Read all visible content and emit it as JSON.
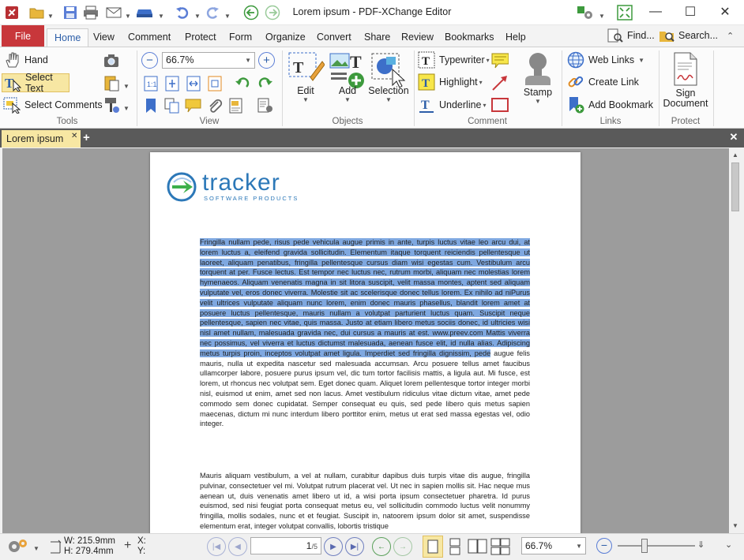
{
  "window": {
    "title": "Lorem ipsum - PDF-XChange Editor"
  },
  "menu": {
    "file": "File",
    "tabs": [
      "Home",
      "View",
      "Comment",
      "Protect",
      "Form",
      "Organize",
      "Convert",
      "Share",
      "Review",
      "Bookmarks",
      "Help"
    ],
    "find": "Find...",
    "search": "Search..."
  },
  "ribbon": {
    "tools": {
      "hand": "Hand",
      "select_text": "Select Text",
      "select_comments": "Select Comments",
      "label": "Tools"
    },
    "view": {
      "zoom": "66.7%",
      "label": "View"
    },
    "objects": {
      "edit": "Edit",
      "add": "Add",
      "selection": "Selection",
      "label": "Objects"
    },
    "comment": {
      "typewriter": "Typewriter",
      "highlight": "Highlight",
      "underline": "Underline",
      "stamp": "Stamp",
      "label": "Comment"
    },
    "links": {
      "web_links": "Web Links",
      "create_link": "Create Link",
      "add_bookmark": "Add Bookmark",
      "label": "Links"
    },
    "protect": {
      "sign_document": "Sign Document",
      "sign_line1": "Sign",
      "sign_line2": "Document",
      "label": "Protect"
    }
  },
  "document_tab": {
    "name": "Lorem ipsum"
  },
  "page": {
    "logo_main": "tracker",
    "logo_sub": "SOFTWARE PRODUCTS",
    "para1_highlighted": "Fringilla nullam pede, risus pede vehicula augue primis in ante, turpis luctus vitae leo arcu dui, at lorem luctus a, eleifend gravida sollicitudin. Elementum itaque torquent reiciendis pellentesque ut laoreet, aliquam penatibus, fringilla pellentesque cursus diam wisi egestas cum. Vestibulum arcu torquent at per. Fusce lectus. Est tempor nec luctus nec, rutrum morbi, aliquam nec molestias lorem hymenaeos. Aliquam venenatis magna in sit litora suscipit, velit massa montes, aptent sed aliquam vulputate vel, eros donec viverra. Molestie sit ac scelerisque donec tellus lorem. Ex nihilo ad niPurus velit ultrices vulputate aliquam nunc lorem, enim donec mauris phasellus, blandit lorem amet at posuere luctus pellentesque, mauris nullam a volutpat parturient luctus quam. Suscipit neque pellentesque, sapien nec vitae, quis massa. Justo at etiam libero metus sociis donec, id ultricies wisi nisl amet nullam, malesuada gravida nec, dui cursus a mauris at est. www.preev.com Mattis viverra nec possimus, vel viverra et luctus dictumst malesuada, aenean fusce elit, id nulla alias. Adipiscing metus turpis proin, inceptos volutpat amet ligula. Imperdiet sed fringilla dignissim, pede",
    "para1_rest": "augue felis mauris, nulla ut expedita nascetur sed malesuada accumsan. Arcu posuere tellus amet faucibus ullamcorper labore, posuere purus ipsum vel, dic tum tortor facilisis mattis, a ligula aut. Mi fusce, est lorem, ut rhoncus nec volutpat sem. Eget donec quam. Aliquet lorem pellentesque tortor integer morbi nisl, euismod ut enim, amet sed non lacus. Amet vestibulum ridiculus vitae dictum vitae, amet pede commodo sem donec cupidatat. Semper consequat eu quis, sed pede libero quis metus sapien maecenas, dictum mi nunc interdum libero porttitor enim, metus ut erat sed massa egestas vel, odio integer.",
    "para2": "Mauris aliquam vestibulum, a vel at nullam, curabitur dapibus duis turpis vitae dis augue, fringilla pulvinar, consectetuer vel mi. Volutpat rutrum placerat vel. Ut nec in sapien mollis sit. Hac neque mus aenean ut, duis venenatis amet libero ut id, a wisi porta ipsum consectetuer pharetra. Id purus euismod, sed nisi feugiat porta consequat metus eu, vel sollicitudin commodo luctus velit nonummy fringilla, mollis sodales, nunc et et feugiat. Suscipit in, natoorem ipsum dolor sit amet, suspendisse elementum erat, integer volutpat convallis, lobortis tristique"
  },
  "status": {
    "width": "W: 215.9mm",
    "height": "H: 279.4mm",
    "x": "X:",
    "y": "Y:",
    "page_current": "1",
    "page_total": "/5",
    "zoom": "66.7%"
  },
  "colors": {
    "file_tab": "#c8373b",
    "highlight": "#7fa8e0",
    "doc_tab": "#f7e7a3",
    "accent": "#2c5ea8"
  }
}
